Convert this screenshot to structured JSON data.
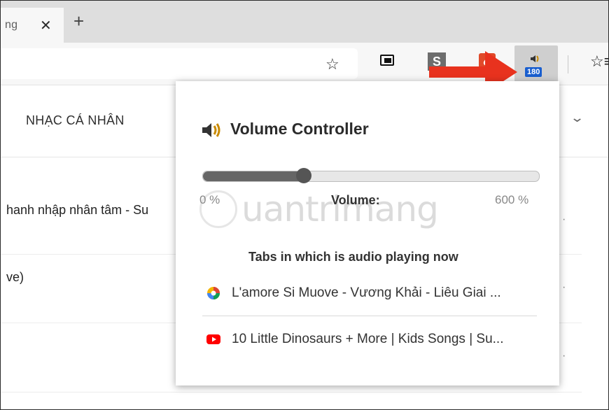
{
  "tab": {
    "title": "ng",
    "close_glyph": "✕"
  },
  "new_tab_glyph": "+",
  "toolbar": {
    "add_favorite_glyph": "☆",
    "s_extension_label": "S",
    "volume_badge": "180",
    "favorites_glyph": "☆≡"
  },
  "page": {
    "nav_personal": "NHẠC CÁ NHÂN",
    "nav_partial": "(",
    "nav_chevron": "⌄",
    "rows": [
      {
        "text": "hanh nhập nhân tâm - Su",
        "dot": "·"
      },
      {
        "text": "ve)",
        "dot": "·"
      },
      {
        "text": "",
        "dot": "·"
      },
      {
        "text": "",
        "dot": ""
      }
    ]
  },
  "popup": {
    "title": "Volume Controller",
    "slider": {
      "value_percent": 30
    },
    "min_label": "0 %",
    "volume_label": "Volume:",
    "max_label": "600 %",
    "watermark": "uantrimang",
    "tabs_heading": "Tabs in which is audio playing now",
    "tabs": [
      {
        "title": "L'amore Si Muove - Vương Khải - Liêu Giai ...",
        "icon": "chrome-music-icon",
        "color": "#e8453c"
      },
      {
        "title": "10 Little Dinosaurs + More | Kids Songs | Su...",
        "icon": "youtube-icon",
        "color": "#ff0000"
      }
    ]
  },
  "colors": {
    "arrow": "#e8321e",
    "badge": "#1a5fcf",
    "youtube": "#ff0000"
  }
}
